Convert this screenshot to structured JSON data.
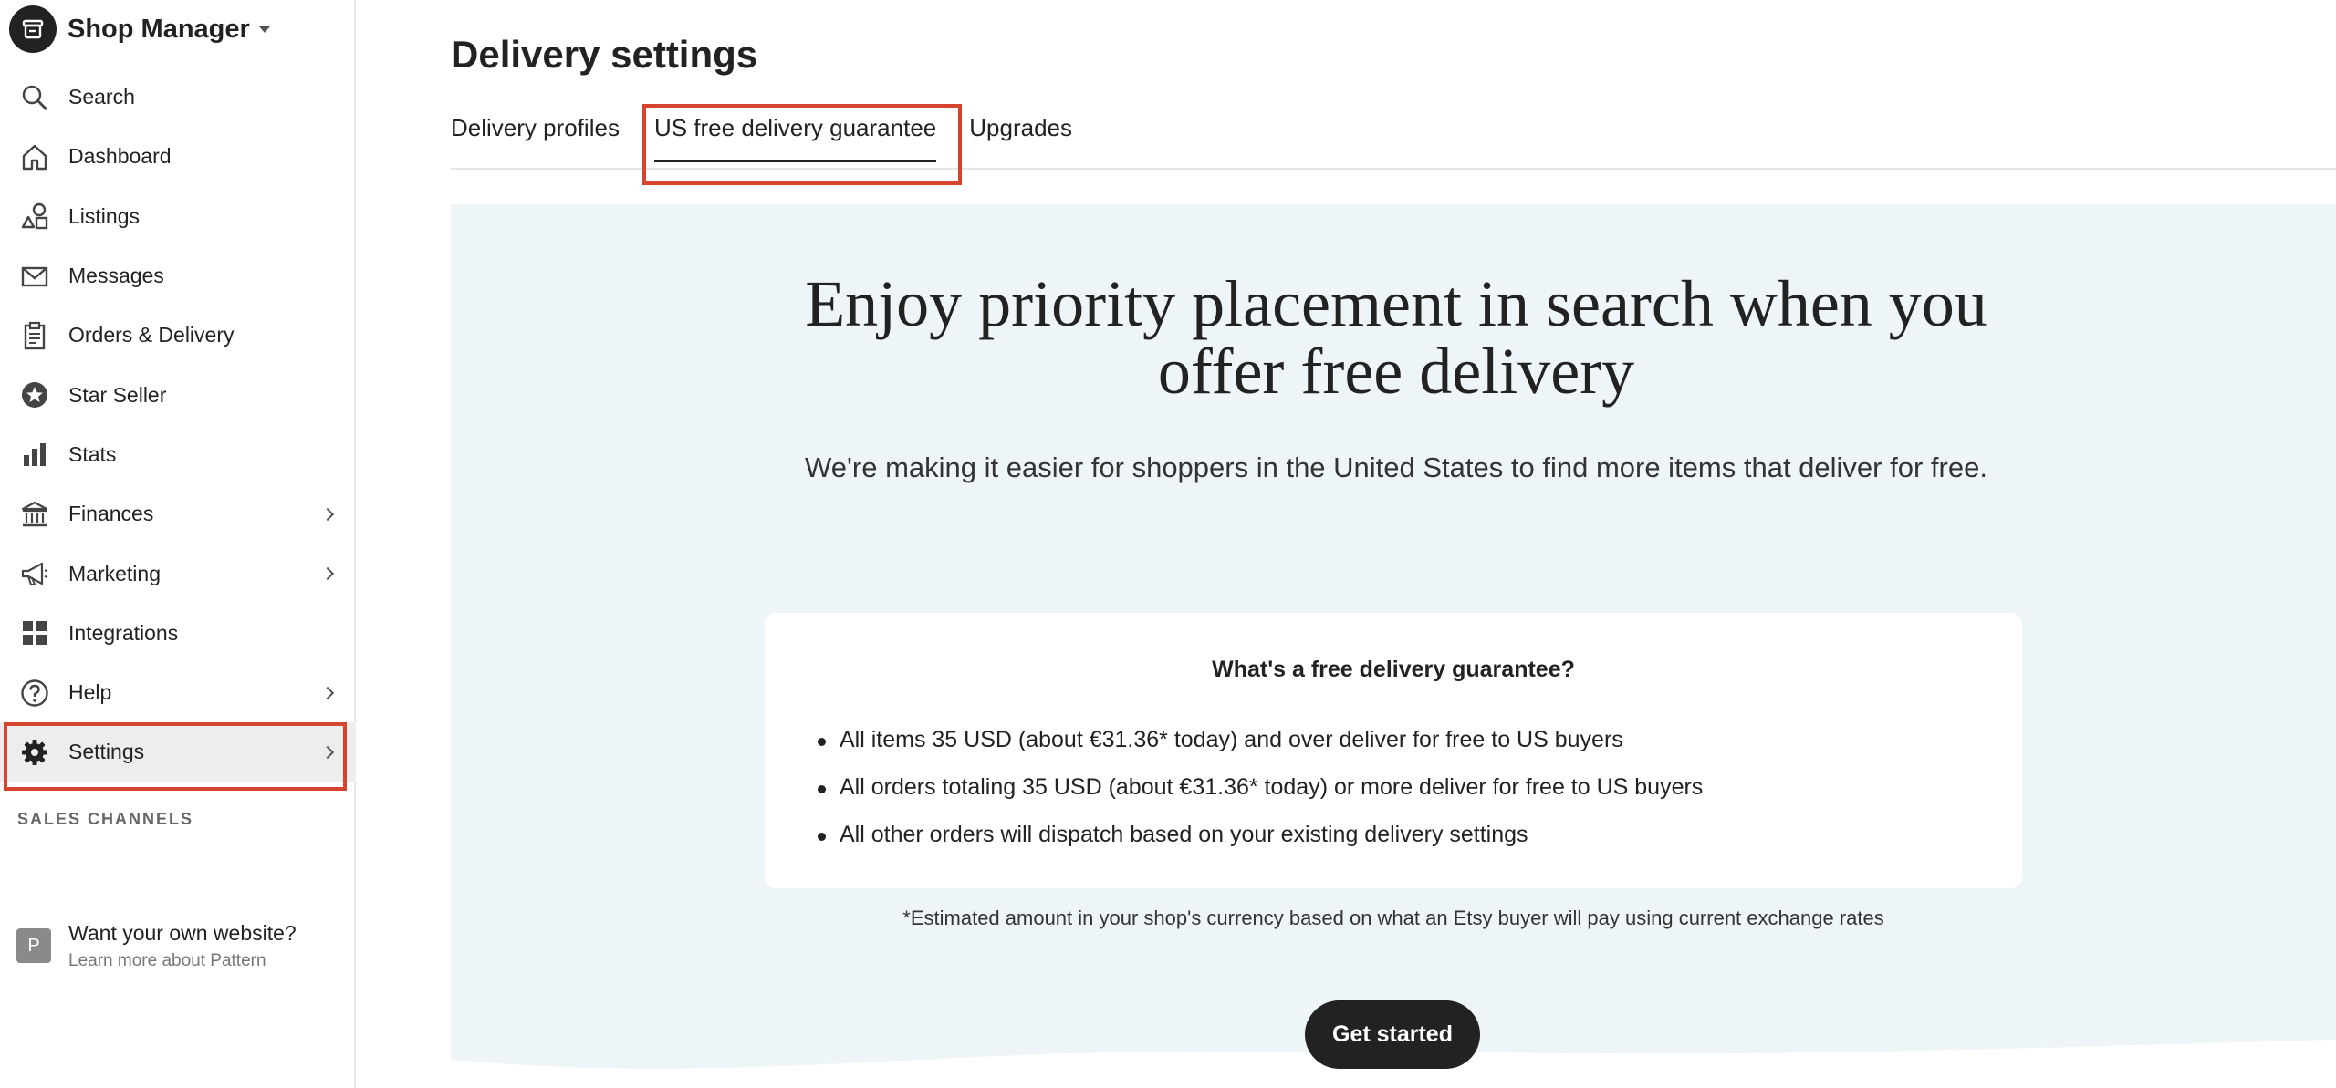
{
  "brand": {
    "title": "Shop Manager"
  },
  "sidebar": {
    "items": [
      {
        "label": "Search",
        "icon": "search-icon"
      },
      {
        "label": "Dashboard",
        "icon": "home-icon"
      },
      {
        "label": "Listings",
        "icon": "shapes-icon"
      },
      {
        "label": "Messages",
        "icon": "envelope-icon"
      },
      {
        "label": "Orders & Delivery",
        "icon": "clipboard-icon"
      },
      {
        "label": "Star Seller",
        "icon": "star-badge-icon"
      },
      {
        "label": "Stats",
        "icon": "bar-chart-icon"
      },
      {
        "label": "Finances",
        "icon": "bank-icon"
      },
      {
        "label": "Marketing",
        "icon": "megaphone-icon"
      },
      {
        "label": "Integrations",
        "icon": "grid-icon"
      },
      {
        "label": "Help",
        "icon": "help-circle-icon"
      },
      {
        "label": "Settings",
        "icon": "gear-icon"
      }
    ],
    "section_label": "SALES CHANNELS",
    "pattern": {
      "badge": "P",
      "title": "Want your own website?",
      "subtitle": "Learn more about Pattern"
    }
  },
  "page": {
    "title": "Delivery settings",
    "tabs": [
      {
        "label": "Delivery profiles"
      },
      {
        "label": "US free delivery guarantee"
      },
      {
        "label": "Upgrades"
      }
    ]
  },
  "hero": {
    "headline": "Enjoy priority placement in search when you offer free delivery",
    "subtext": "We're making it easier for shoppers in the United States to find more items that deliver for free.",
    "card": {
      "title": "What's a free delivery guarantee?",
      "bullets": [
        "All items 35 USD (about €31.36* today) and over deliver for free to US buyers",
        "All orders totaling 35 USD (about €31.36* today) or more deliver for free to US buyers",
        "All other orders will dispatch based on your existing delivery settings"
      ]
    },
    "footnote": "*Estimated amount in your shop's currency based on what an Etsy buyer will pay using current exchange rates",
    "cta": "Get started"
  },
  "colors": {
    "accent_highlight": "#d4442e",
    "hero_background": "#eef5f8",
    "cta_background": "#222222"
  }
}
